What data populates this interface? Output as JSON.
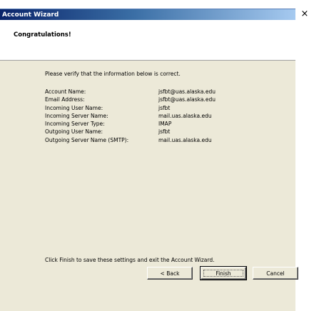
{
  "window": {
    "title": "Account Wizard",
    "close_glyph": "×"
  },
  "header": {
    "heading": "Congratulations!"
  },
  "main": {
    "verify_text": "Please verify that the information below is correct.",
    "rows": [
      {
        "label": "Account Name:",
        "value": "jsfbt@uas.alaska.edu"
      },
      {
        "label": "Email Address:",
        "value": "jsfbt@uas.alaska.edu"
      },
      {
        "label": "Incoming User Name:",
        "value": "jsfbt"
      },
      {
        "label": "Incoming Server Name:",
        "value": "mail.uas.alaska.edu"
      },
      {
        "label": "Incoming Server Type:",
        "value": "IMAP"
      },
      {
        "label": "Outgoing User Name:",
        "value": "jsfbt"
      },
      {
        "label": "Outgoing Server Name (SMTP):",
        "value": "mail.uas.alaska.edu"
      }
    ],
    "finish_note": "Click Finish to save these settings and exit the Account Wizard."
  },
  "buttons": {
    "back": "< Back",
    "finish": "Finish",
    "cancel": "Cancel"
  }
}
